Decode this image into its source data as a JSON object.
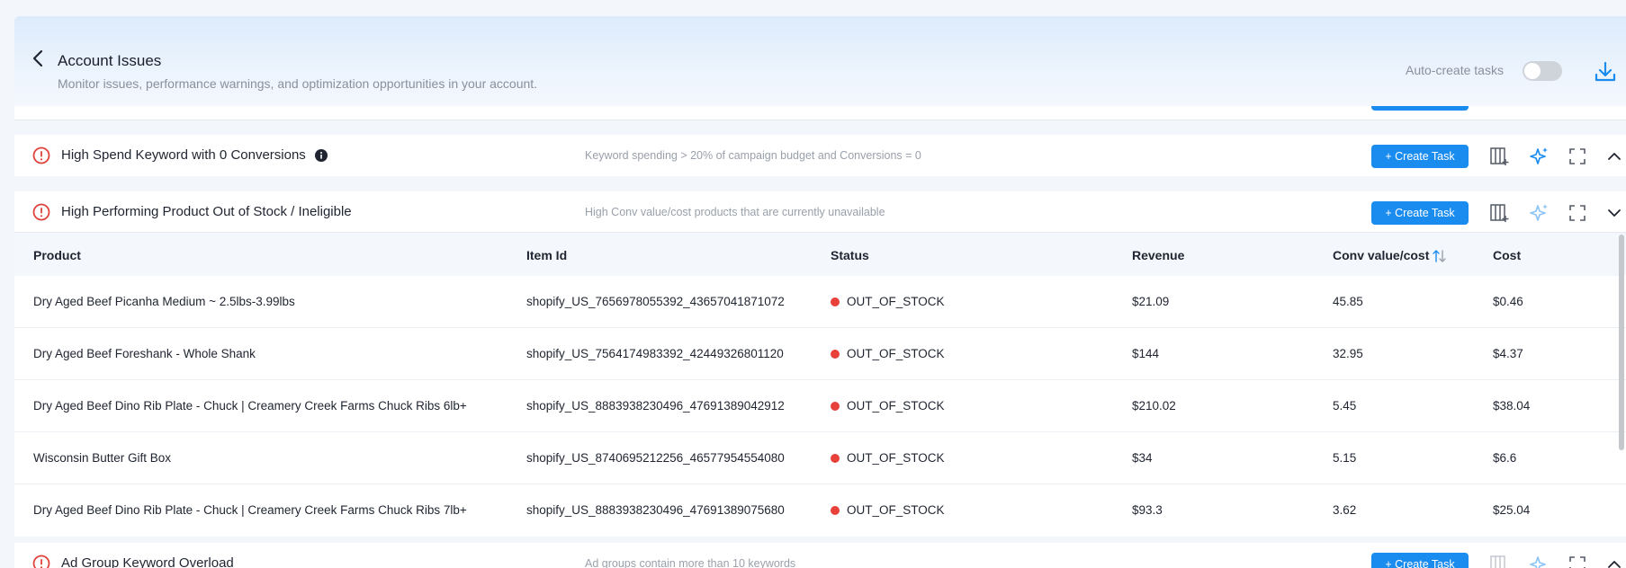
{
  "header": {
    "title": "Account Issues",
    "subtitle": "Monitor issues, performance warnings, and optimization opportunities in your account.",
    "auto_create_label": "Auto-create tasks",
    "auto_create_enabled": false
  },
  "colors": {
    "accent": "#1a8cf0",
    "alert": "#e0413b",
    "status_out_of_stock": "#e8413b",
    "ai_icon": "#1a8cf0"
  },
  "issues": [
    {
      "title": "High Spend Keyword with 0 Conversions",
      "description": "Keyword spending > 20% of campaign budget and Conversions = 0",
      "create_task_label": "+ Create Task",
      "expanded": false
    },
    {
      "title": "High Performing Product Out of Stock / Ineligible",
      "description": "High Conv value/cost products that are currently unavailable",
      "create_task_label": "+ Create Task",
      "expanded": true
    },
    {
      "title": "Ad Group Keyword Overload",
      "description": "Ad groups contain more than 10 keywords",
      "create_task_label": "+ Create Task",
      "expanded": false
    }
  ],
  "table": {
    "columns": [
      "Product",
      "Item Id",
      "Status",
      "Revenue",
      "Conv value/cost",
      "Cost"
    ],
    "rows": [
      {
        "product": "Dry Aged Beef Picanha Medium ~ 2.5lbs-3.99lbs",
        "item_id": "shopify_US_7656978055392_43657041871072",
        "status": "OUT_OF_STOCK",
        "revenue": "$21.09",
        "conv": "45.85",
        "cost": "$0.46"
      },
      {
        "product": "Dry Aged Beef Foreshank - Whole Shank",
        "item_id": "shopify_US_7564174983392_42449326801120",
        "status": "OUT_OF_STOCK",
        "revenue": "$144",
        "conv": "32.95",
        "cost": "$4.37"
      },
      {
        "product": "Dry Aged Beef Dino Rib Plate - Chuck | Creamery Creek Farms Chuck Ribs 6lb+",
        "item_id": "shopify_US_8883938230496_47691389042912",
        "status": "OUT_OF_STOCK",
        "revenue": "$210.02",
        "conv": "5.45",
        "cost": "$38.04"
      },
      {
        "product": "Wisconsin Butter Gift Box",
        "item_id": "shopify_US_8740695212256_46577954554080",
        "status": "OUT_OF_STOCK",
        "revenue": "$34",
        "conv": "5.15",
        "cost": "$6.6"
      },
      {
        "product": "Dry Aged Beef Dino Rib Plate - Chuck | Creamery Creek Farms Chuck Ribs 7lb+",
        "item_id": "shopify_US_8883938230496_47691389075680",
        "status": "OUT_OF_STOCK",
        "revenue": "$93.3",
        "conv": "3.62",
        "cost": "$25.04"
      }
    ]
  }
}
